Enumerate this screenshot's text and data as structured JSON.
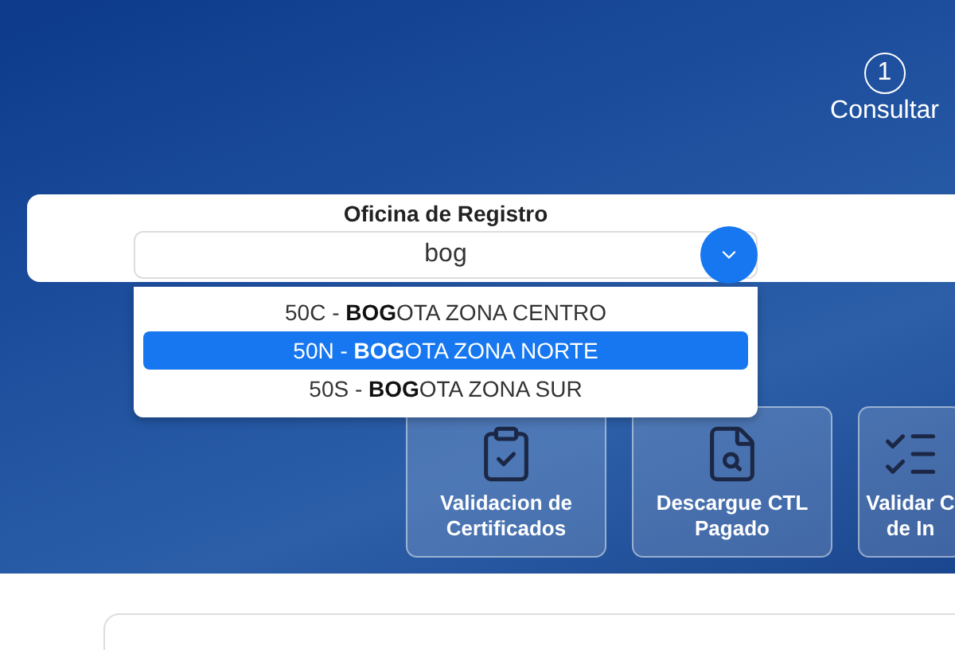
{
  "step": {
    "number": "1",
    "label": "Consultar"
  },
  "office_field": {
    "label": "Oficina de Registro",
    "value": "bog",
    "expanded": true,
    "options": [
      {
        "text": "50C - **BOG**OTA ZONA CENTRO",
        "selected": false
      },
      {
        "text": "50N - **BOG**OTA ZONA NORTE",
        "selected": true
      },
      {
        "text": "50S - **BOG**OTA ZONA SUR",
        "selected": false
      }
    ]
  },
  "tiles": [
    {
      "kind": "checklist",
      "lines": [
        "Validacion de",
        "Certificados"
      ]
    },
    {
      "kind": "document-search",
      "lines": [
        "Descargue CTL",
        "Pagado"
      ]
    },
    {
      "kind": "list",
      "lines": [
        "Validar C",
        "de In"
      ]
    }
  ]
}
